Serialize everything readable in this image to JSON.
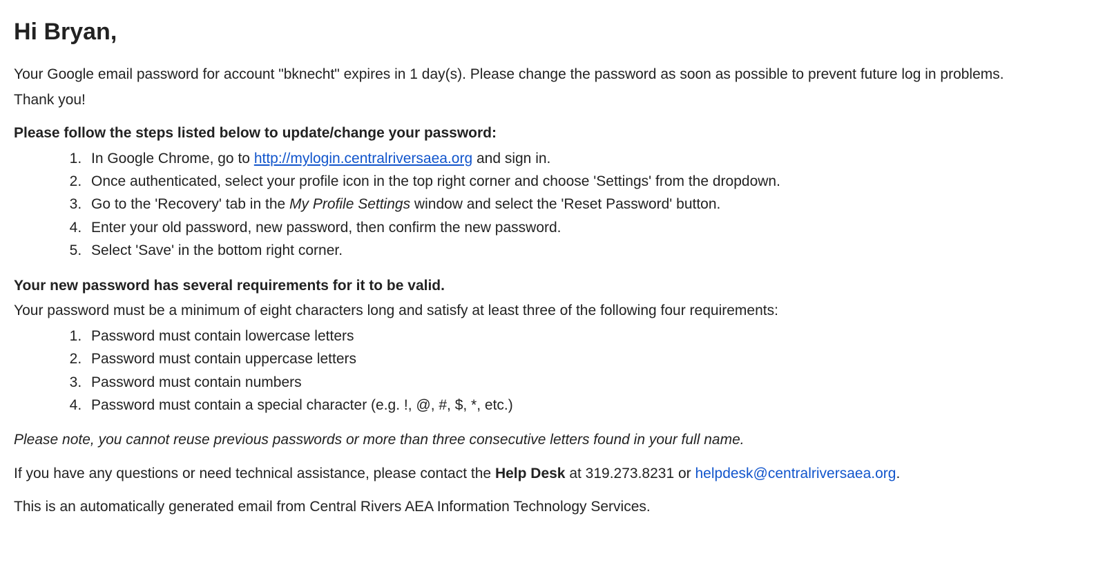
{
  "greeting": "Hi Bryan,",
  "intro": {
    "line1": "Your Google email password for account \"bknecht\" expires in 1 day(s). Please change the password as soon as possible to prevent future log in problems.",
    "line2": "Thank you!"
  },
  "stepsHeading": "Please follow the steps listed below to update/change your password:",
  "steps": {
    "s1_pre": "In Google Chrome, go to ",
    "s1_link": "http://mylogin.centralriversaea.org",
    "s1_post": " and sign in.",
    "s2": "Once authenticated, select your profile icon in the top right corner and choose 'Settings' from the dropdown.",
    "s3_pre": "Go to the 'Recovery' tab in the ",
    "s3_em": "My Profile Settings",
    "s3_post": " window and select the 'Reset Password' button.",
    "s4": "Enter your old password, new password, then confirm the new password.",
    "s5": "Select 'Save' in the bottom right corner."
  },
  "reqHeading": "Your new password has several requirements for it to be valid.",
  "reqIntro": "Your password must be a minimum of eight characters long and satisfy at least three of the following four requirements:",
  "requirements": {
    "r1": "Password must contain lowercase letters",
    "r2": "Password must contain uppercase letters",
    "r3": "Password must contain numbers",
    "r4": "Password must contain a special character (e.g. !, @, #, $, *, etc.)"
  },
  "note": "Please note, you cannot reuse previous passwords or more than three consecutive letters found in your full name.",
  "contact": {
    "pre": "If you have any questions or need technical assistance, please contact the ",
    "bold": "Help Desk",
    "mid": " at 319.273.8231 or ",
    "email": "helpdesk@centralriversaea.org",
    "post": "."
  },
  "footer": "This is an automatically generated email from Central Rivers AEA Information Technology Services."
}
